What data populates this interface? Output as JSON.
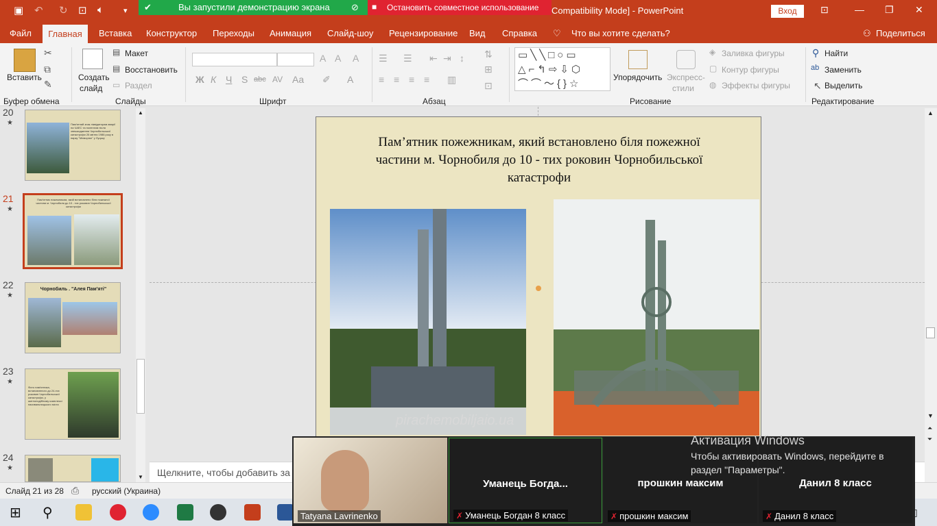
{
  "titlebar": {
    "sharing_status": "Вы запустили демонстрацию экрана",
    "stop_sharing": "Остановить совместное использование",
    "doc_title": "Compatibility Mode]  -  PowerPoint",
    "signin": "Вход"
  },
  "tabs": [
    {
      "label": "Файл"
    },
    {
      "label": "Главная"
    },
    {
      "label": "Вставка"
    },
    {
      "label": "Конструктор"
    },
    {
      "label": "Переходы"
    },
    {
      "label": "Анимация"
    },
    {
      "label": "Слайд-шоу"
    },
    {
      "label": "Рецензирование"
    },
    {
      "label": "Вид"
    },
    {
      "label": "Справка"
    },
    {
      "label": "Что вы хотите сделать?"
    },
    {
      "label": "Поделиться"
    }
  ],
  "ribbon": {
    "clipboard": {
      "paste": "Вставить",
      "group": "Буфер обмена"
    },
    "slides": {
      "new_slide_1": "Создать",
      "new_slide_2": "слайд",
      "layout": "Макет",
      "reset": "Восстановить",
      "section": "Раздел",
      "group": "Слайды"
    },
    "font": {
      "bold": "Ж",
      "italic": "К",
      "underline": "Ч",
      "shadow": "S",
      "strike": "abc",
      "spacing": "AV",
      "case": "Aa",
      "color": "A",
      "group": "Шрифт"
    },
    "paragraph": {
      "group": "Абзац"
    },
    "drawing": {
      "arrange": "Упорядочить",
      "quick_styles_1": "Экспресс-",
      "quick_styles_2": "стили",
      "fill": "Заливка фигуры",
      "outline": "Контур фигуры",
      "effects": "Эффекты фигуры",
      "group": "Рисование"
    },
    "editing": {
      "find": "Найти",
      "replace": "Заменить",
      "select": "Выделить",
      "group": "Редактирование"
    }
  },
  "slides": [
    {
      "num": "20",
      "text": "Пам'ятний знак ліквідаторам аварії на ЧАЕС та полеглим після знешкодження Чорнобильської катастрофи 26 квітня 1986 року в парку \"Меморіал\" у Луцьку"
    },
    {
      "num": "21",
      "text": "Пам'ятник пожежникам, який встановлено біля пожежної частини м. Чорнобиля до 10 - тих роковин Чорнобильської катастрофи"
    },
    {
      "num": "22",
      "text": "Чорнобиль . \"Алея Пам'яті\""
    },
    {
      "num": "23",
      "text": "Фото пам'ятника, встановленого до 24-тих роковин Чорнобильської катастрофи, у житлоподібному комплексі пасивальницького міста"
    },
    {
      "num": "24",
      "text": ""
    }
  ],
  "slide": {
    "title": "Пам’ятник пожежникам, який встановлено біля пожежної частини м. Чорнобиля до 10 - тих роковин Чорнобильської катастрофи",
    "watermark": "pirachemobiljaio.ua"
  },
  "notes": {
    "placeholder": "Щелкните, чтобы добавить за"
  },
  "status": {
    "slide": "Слайд 21 из 28",
    "language": "русский (Украина)"
  },
  "zoom": {
    "self": {
      "name": "Tatyana Lavrinenko"
    },
    "participants": [
      {
        "title": "Уманець  Богда...",
        "label": "Уманець Богдан 8 класс"
      },
      {
        "title": "прошкин максим",
        "label": "прошкин максим"
      },
      {
        "title": "Данил 8 класс",
        "label": "Данил 8 класс"
      }
    ]
  },
  "activation": {
    "title": "Активация Windows",
    "text": "Чтобы активировать Windows, перейдите в раздел \"Параметры\"."
  },
  "colors": {
    "accent": "#c43e1c",
    "share_green": "#21a849",
    "share_red": "#e02331"
  }
}
